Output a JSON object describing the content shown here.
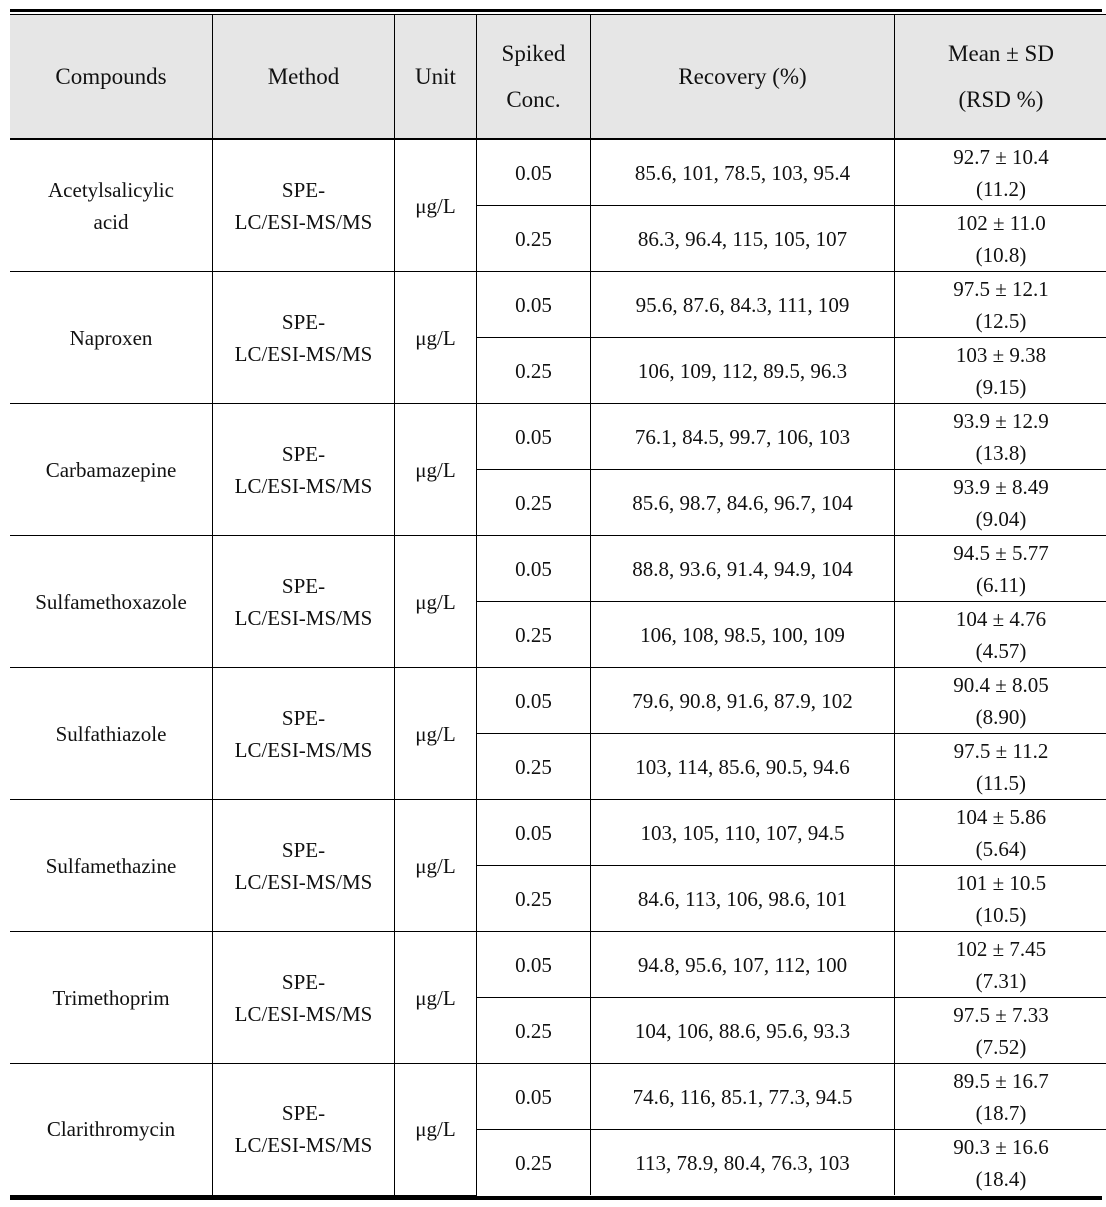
{
  "table": {
    "headers": {
      "compounds": "Compounds",
      "method": "Method",
      "unit": "Unit",
      "spiked_line1": "Spiked",
      "spiked_line2": "Conc.",
      "recovery": "Recovery (%)",
      "mean_line1": "Mean ± SD",
      "mean_line2": "(RSD %)"
    },
    "groups": [
      {
        "compound_line1": "Acetylsalicylic",
        "compound_line2": "acid",
        "method_line1": "SPE-",
        "method_line2": "LC/ESI-MS/MS",
        "unit": "μg/L",
        "rows": [
          {
            "spiked": "0.05",
            "recovery": "85.6, 101, 78.5, 103, 95.4",
            "mean_sd": "92.7 ± 10.4",
            "rsd": "(11.2)"
          },
          {
            "spiked": "0.25",
            "recovery": "86.3, 96.4, 115, 105, 107",
            "mean_sd": "102 ± 11.0",
            "rsd": "(10.8)"
          }
        ]
      },
      {
        "compound_line1": "Naproxen",
        "compound_line2": "",
        "method_line1": "SPE-",
        "method_line2": "LC/ESI-MS/MS",
        "unit": "μg/L",
        "rows": [
          {
            "spiked": "0.05",
            "recovery": "95.6, 87.6, 84.3, 111, 109",
            "mean_sd": "97.5 ± 12.1",
            "rsd": "(12.5)"
          },
          {
            "spiked": "0.25",
            "recovery": "106, 109, 112, 89.5, 96.3",
            "mean_sd": "103 ± 9.38",
            "rsd": "(9.15)"
          }
        ]
      },
      {
        "compound_line1": "Carbamazepine",
        "compound_line2": "",
        "method_line1": "SPE-",
        "method_line2": "LC/ESI-MS/MS",
        "unit": "μg/L",
        "rows": [
          {
            "spiked": "0.05",
            "recovery": "76.1, 84.5, 99.7, 106, 103",
            "mean_sd": "93.9 ± 12.9",
            "rsd": "(13.8)"
          },
          {
            "spiked": "0.25",
            "recovery": "85.6, 98.7, 84.6, 96.7, 104",
            "mean_sd": "93.9 ± 8.49",
            "rsd": "(9.04)"
          }
        ]
      },
      {
        "compound_line1": "Sulfamethoxazole",
        "compound_line2": "",
        "method_line1": "SPE-",
        "method_line2": "LC/ESI-MS/MS",
        "unit": "μg/L",
        "rows": [
          {
            "spiked": "0.05",
            "recovery": "88.8, 93.6, 91.4, 94.9, 104",
            "mean_sd": "94.5 ± 5.77",
            "rsd": "(6.11)"
          },
          {
            "spiked": "0.25",
            "recovery": "106, 108, 98.5, 100, 109",
            "mean_sd": "104 ± 4.76",
            "rsd": "(4.57)"
          }
        ]
      },
      {
        "compound_line1": "Sulfathiazole",
        "compound_line2": "",
        "method_line1": "SPE-",
        "method_line2": "LC/ESI-MS/MS",
        "unit": "μg/L",
        "rows": [
          {
            "spiked": "0.05",
            "recovery": "79.6, 90.8, 91.6, 87.9, 102",
            "mean_sd": "90.4 ± 8.05",
            "rsd": "(8.90)"
          },
          {
            "spiked": "0.25",
            "recovery": "103, 114, 85.6, 90.5, 94.6",
            "mean_sd": "97.5 ± 11.2",
            "rsd": "(11.5)"
          }
        ]
      },
      {
        "compound_line1": "Sulfamethazine",
        "compound_line2": "",
        "method_line1": "SPE-",
        "method_line2": "LC/ESI-MS/MS",
        "unit": "μg/L",
        "rows": [
          {
            "spiked": "0.05",
            "recovery": "103, 105, 110, 107, 94.5",
            "mean_sd": "104 ± 5.86",
            "rsd": "(5.64)"
          },
          {
            "spiked": "0.25",
            "recovery": "84.6, 113, 106, 98.6, 101",
            "mean_sd": "101 ± 10.5",
            "rsd": "(10.5)"
          }
        ]
      },
      {
        "compound_line1": "Trimethoprim",
        "compound_line2": "",
        "method_line1": "SPE-",
        "method_line2": "LC/ESI-MS/MS",
        "unit": "μg/L",
        "rows": [
          {
            "spiked": "0.05",
            "recovery": "94.8, 95.6, 107, 112, 100",
            "mean_sd": "102 ± 7.45",
            "rsd": "(7.31)"
          },
          {
            "spiked": "0.25",
            "recovery": "104, 106, 88.6, 95.6, 93.3",
            "mean_sd": "97.5 ± 7.33",
            "rsd": "(7.52)"
          }
        ]
      },
      {
        "compound_line1": "Clarithromycin",
        "compound_line2": "",
        "method_line1": "SPE-",
        "method_line2": "LC/ESI-MS/MS",
        "unit": "μg/L",
        "rows": [
          {
            "spiked": "0.05",
            "recovery": "74.6, 116, 85.1, 77.3, 94.5",
            "mean_sd": "89.5 ± 16.7",
            "rsd": "(18.7)"
          },
          {
            "spiked": "0.25",
            "recovery": "113, 78.9, 80.4, 76.3, 103",
            "mean_sd": "90.3 ± 16.6",
            "rsd": "(18.4)"
          }
        ]
      }
    ]
  }
}
